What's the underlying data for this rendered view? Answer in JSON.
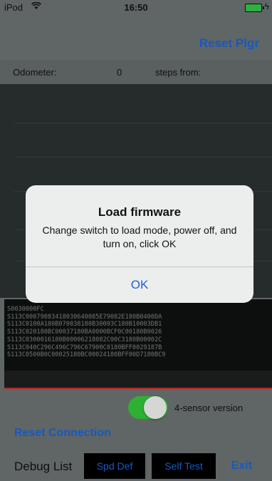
{
  "status_bar": {
    "carrier": "iPod",
    "wifi_icon": "wifi-icon",
    "time": "16:50",
    "battery_icon": "battery-icon",
    "charging_icon": "bolt-icon"
  },
  "header": {
    "reset_plgr": "Reset Plgr"
  },
  "odometer": {
    "label": "Odometer:",
    "value": "0",
    "steps_label": "steps from:"
  },
  "log": {
    "lines": [
      "S0030000FC",
      "S113C00079083418030640085E79082E180B0400DA",
      "S113C0100A180B070038180B30003C180B10003DB1",
      "S113C020180BC00037180BA0000BCF0C00180B0026",
      "S113C0300016180B00006218082C00C3180B00002C",
      "S113C040C296C496C796C67900C0180BFF0029187B",
      "S113C0500B0C00025180BC00024180BFF00D7180BC9"
    ]
  },
  "toggle": {
    "label": "4-sensor version",
    "state": "on"
  },
  "reset_connection": "Reset Connection",
  "footer": {
    "debug_list": "Debug List",
    "spd_def": "Spd Def",
    "self_test": "Self Test",
    "exit": "Exit"
  },
  "dialog": {
    "title": "Load firmware",
    "message": "Change switch to load mode, power off, and turn on, click OK",
    "ok": "OK"
  },
  "colors": {
    "accent": "#1a63d8",
    "toggle_on": "#34c43b",
    "divider_red": "#c92a2a"
  }
}
